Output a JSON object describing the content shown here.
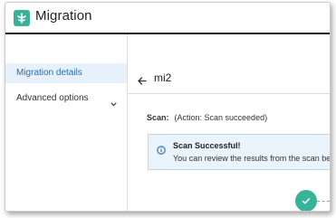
{
  "app": {
    "title": "Migration"
  },
  "sidebar": {
    "items": [
      {
        "label": "Migration details",
        "active": true
      },
      {
        "label": "Advanced options",
        "expandable": true
      }
    ]
  },
  "main": {
    "page_title": "mi2",
    "scan": {
      "label": "Scan:",
      "value": "(Action: Scan succeeded)"
    },
    "alert": {
      "title": "Scan Successful!",
      "body": "You can review the results from the scan below"
    }
  },
  "colors": {
    "brand": "#38b39a",
    "accent": "#2b6cb0",
    "alert_bg": "#eaf4fc"
  },
  "icons": {
    "logo": "tree-icon",
    "back": "back-arrow-icon",
    "expand": "chevron-down-icon",
    "info": "info-icon",
    "step": "checkmark-icon"
  }
}
